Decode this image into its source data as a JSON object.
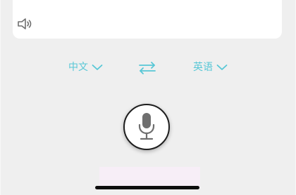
{
  "colors": {
    "background": "#efefef",
    "card": "#ffffff",
    "accent": "#57c7d6",
    "mic_icon": "#6f6f6f",
    "speaker_icon": "#6f6f6f",
    "home_indicator": "#0e0e0e"
  },
  "translation_card": {
    "speaker_icon": "speaker-icon"
  },
  "language_bar": {
    "source_language": "中文",
    "target_language": "英语",
    "source_icon": "chevron-down-icon",
    "target_icon": "chevron-down-icon",
    "swap_icon": "swap-arrows-icon"
  },
  "voice_input": {
    "icon": "microphone-icon"
  },
  "system": {
    "home_indicator": "home-indicator"
  }
}
